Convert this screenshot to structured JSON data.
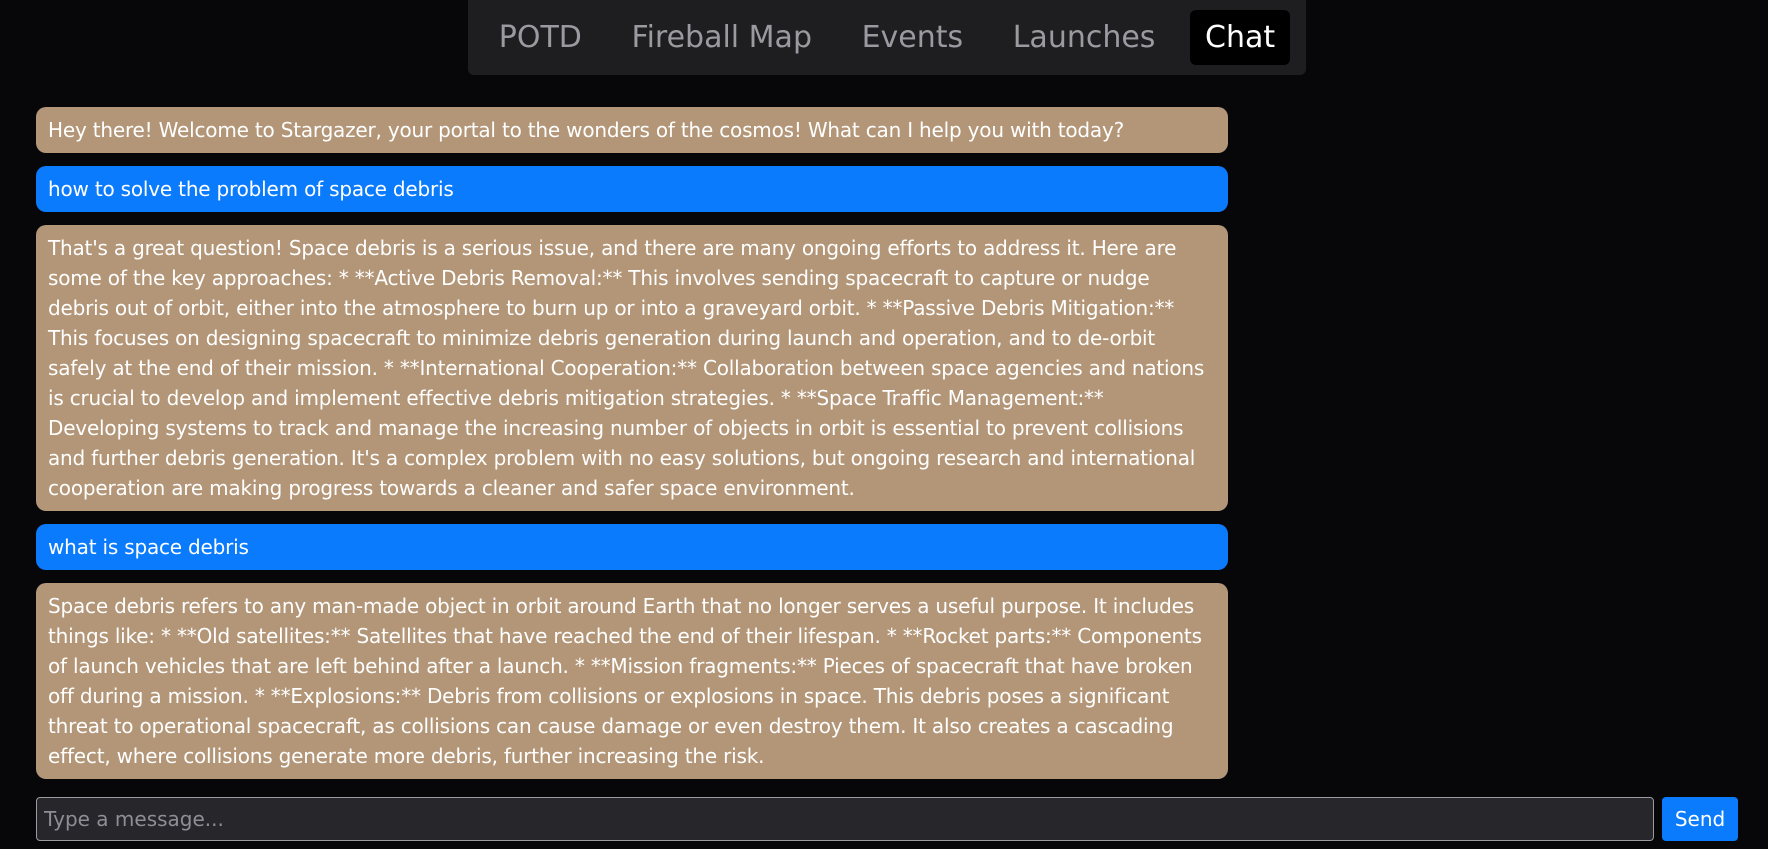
{
  "nav": {
    "tabs": [
      {
        "label": "POTD"
      },
      {
        "label": "Fireball Map"
      },
      {
        "label": "Events"
      },
      {
        "label": "Launches"
      },
      {
        "label": "Chat"
      }
    ],
    "active": "Chat"
  },
  "chat": {
    "messages": [
      {
        "role": "bot",
        "text": "Hey there! Welcome to Stargazer, your portal to the wonders of the cosmos! What can I help you with today?"
      },
      {
        "role": "user",
        "text": "how to solve the problem of space debris"
      },
      {
        "role": "bot",
        "text": "That's a great question! Space debris is a serious issue, and there are many ongoing efforts to address it. Here are some of the key approaches: * **Active Debris Removal:** This involves sending spacecraft to capture or nudge debris out of orbit, either into the atmosphere to burn up or into a graveyard orbit. * **Passive Debris Mitigation:** This focuses on designing spacecraft to minimize debris generation during launch and operation, and to de-orbit safely at the end of their mission. * **International Cooperation:** Collaboration between space agencies and nations is crucial to develop and implement effective debris mitigation strategies. * **Space Traffic Management:** Developing systems to track and manage the increasing number of objects in orbit is essential to prevent collisions and further debris generation. It's a complex problem with no easy solutions, but ongoing research and international cooperation are making progress towards a cleaner and safer space environment."
      },
      {
        "role": "user",
        "text": "what is space debris"
      },
      {
        "role": "bot",
        "text": "Space debris refers to any man-made object in orbit around Earth that no longer serves a useful purpose. It includes things like: * **Old satellites:** Satellites that have reached the end of their lifespan. * **Rocket parts:** Components of launch vehicles that are left behind after a launch. * **Mission fragments:** Pieces of spacecraft that have broken off during a mission. * **Explosions:** Debris from collisions or explosions in space. This debris poses a significant threat to operational spacecraft, as collisions can cause damage or even destroy them. It also creates a cascading effect, where collisions generate more debris, further increasing the risk."
      }
    ]
  },
  "composer": {
    "placeholder": "Type a message...",
    "value": "",
    "send_label": "Send"
  },
  "colors": {
    "background": "#07070a",
    "bot_bubble": "#b39677",
    "user_bubble": "#0a7bfc",
    "nav_bg": "#1e1e21",
    "accent": "#0a7bfc"
  }
}
